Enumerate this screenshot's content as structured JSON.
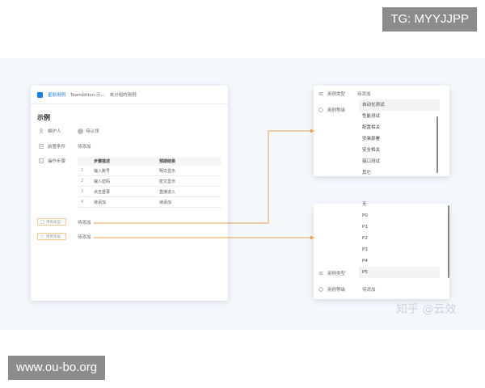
{
  "badges": {
    "tg": "TG: MYYJJPP",
    "site": "www.ou-bo.org"
  },
  "main_card": {
    "brand": "星辰用例",
    "crumbs": [
      "Teambition 示...",
      "未分组的用例"
    ],
    "title": "示例",
    "fields": [
      {
        "label": "维护人",
        "value": "待认领"
      },
      {
        "label": "前置条件",
        "value": "待添加"
      },
      {
        "label": "操作步骤",
        "value": ""
      }
    ],
    "table": {
      "headers": [
        "步骤描述",
        "预期结果"
      ],
      "rows": [
        {
          "num": "1",
          "step": "输入账号",
          "result": "明文显示"
        },
        {
          "num": "2",
          "step": "输入密码",
          "result": "密文显示"
        },
        {
          "num": "3",
          "step": "点击登录",
          "result": "直接进入"
        },
        {
          "num": "4",
          "step": "待添加",
          "result": "待添加"
        }
      ]
    },
    "tags": [
      {
        "label": "用例类型",
        "value": "待添加"
      },
      {
        "label": "用例等级",
        "value": "待添加"
      }
    ]
  },
  "dropdown_type": {
    "field_type_label": "用例类型",
    "field_type_value": "待添加",
    "field_level_label": "用例等级",
    "options": [
      "自动化测试",
      "性能测试",
      "配置相关",
      "安装部署",
      "安全相关",
      "接口测试",
      "其它"
    ],
    "active_index": 0
  },
  "dropdown_level": {
    "options": [
      "无",
      "P0",
      "P1",
      "P2",
      "P3",
      "P4",
      "P5"
    ],
    "active_index": 6,
    "field_type_label": "用例类型",
    "field_level_label": "用例等级",
    "field_level_value": "待添加"
  },
  "watermark": "知乎 @云效",
  "colors": {
    "accent": "#1b7cf0",
    "connector": "#f0a04b",
    "band": "#f3f8fd"
  },
  "icons": [
    "logo-icon",
    "user-icon",
    "document-icon",
    "list-icon",
    "tag-icon",
    "circle-icon"
  ]
}
